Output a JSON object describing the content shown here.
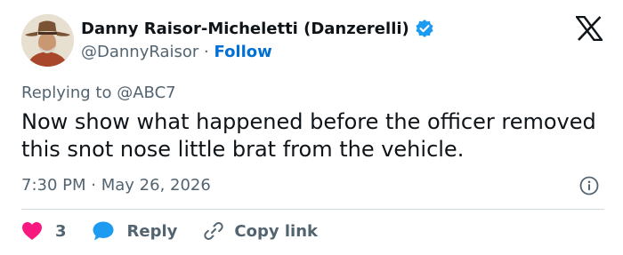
{
  "author": {
    "display_name": "Danny Raisor-Micheletti (Danzerelli)",
    "handle": "@DannyRaisor",
    "separator": "·",
    "follow_label": "Follow",
    "verified_color": "#1d9bf0"
  },
  "reply_context": {
    "prefix": "Replying to",
    "mention": "@ABC7"
  },
  "tweet": {
    "text": "Now show what happened before the officer removed this snot nose little brat from the vehicle.",
    "time": "7:30 PM",
    "separator": "·",
    "date": "May 26, 2026"
  },
  "actions": {
    "like_count": "3",
    "reply_label": "Reply",
    "copy_label": "Copy link",
    "like_color": "#f91880",
    "reply_color": "#1d9bf0"
  },
  "icons": {
    "logo": "x-logo-icon",
    "verified": "verified-badge-icon",
    "info": "info-icon",
    "like": "heart-icon",
    "reply": "speech-bubble-icon",
    "copy": "link-icon"
  }
}
